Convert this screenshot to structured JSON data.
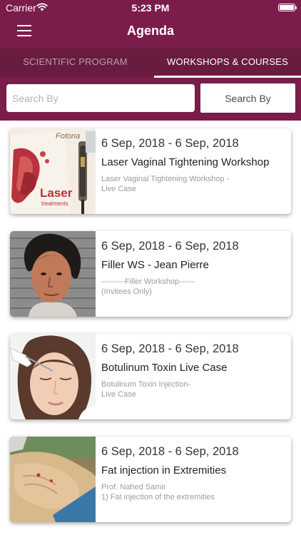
{
  "status_bar": {
    "carrier": "Carrier",
    "time": "5:23 PM",
    "wifi_icon": "wifi-icon",
    "battery_icon": "battery-full-icon"
  },
  "header": {
    "menu_icon": "hamburger-menu-icon",
    "title": "Agenda",
    "background_color": "#7a1d4a"
  },
  "tabs": [
    {
      "label": "SCIENTIFIC PROGRAM",
      "active": false
    },
    {
      "label": "WORKSHOPS & COURSES",
      "active": true
    }
  ],
  "search": {
    "placeholder": "Search By",
    "button_label": "Search By"
  },
  "workshops": [
    {
      "date": "6 Sep, 2018 - 6 Sep, 2018",
      "title": "Laser Vaginal Tightening Workshop",
      "description": "Laser Vaginal Tightening Workshop -\nLive Case",
      "image": "laser-device-photo",
      "image_text": [
        "Fotona",
        "Laser",
        "treatments"
      ]
    },
    {
      "date": "6 Sep, 2018 - 6 Sep, 2018",
      "title": "Filler WS - Jean Pierre",
      "description": "---------Filler Workshop------\n(Invitees Only)",
      "image": "speaker-portrait-photo"
    },
    {
      "date": "6 Sep, 2018 - 6 Sep, 2018",
      "title": "Botulinum Toxin Live Case",
      "description": "Botulinum Toxin Injection-\nLive Case",
      "image": "botox-injection-photo"
    },
    {
      "date": "6 Sep, 2018 - 6 Sep, 2018",
      "title": "Fat injection in Extremities",
      "description": "Prof. Nahed Samir\n1) Fat injection of the extremities",
      "image": "hand-injection-photo"
    }
  ]
}
